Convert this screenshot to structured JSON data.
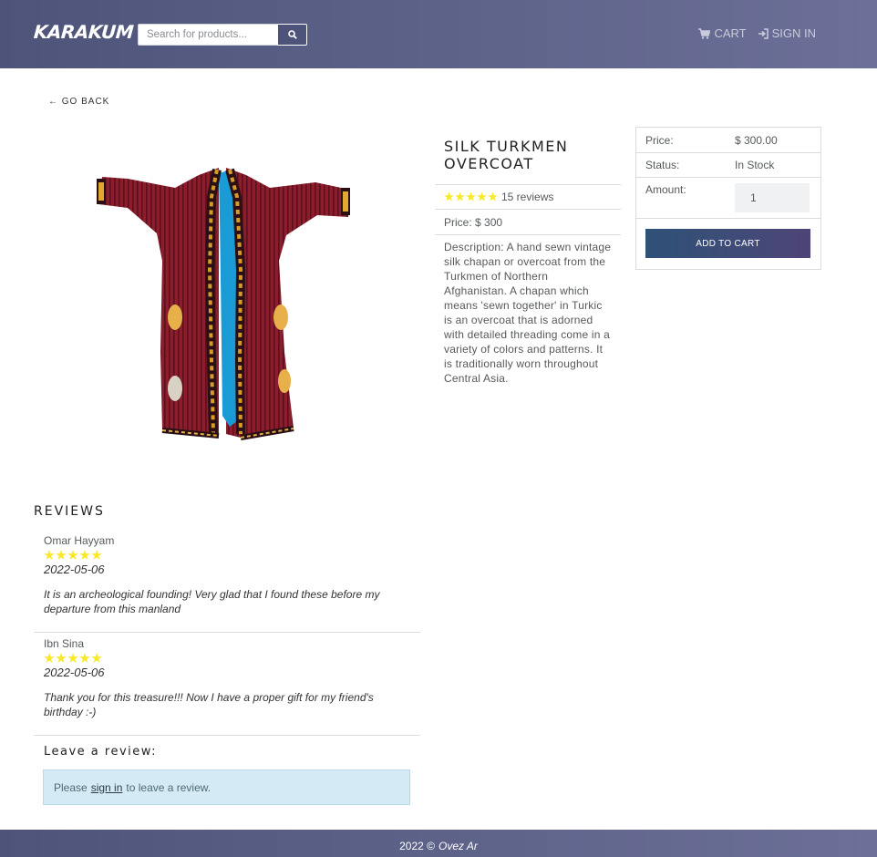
{
  "navbar": {
    "brand": "KARAKUM",
    "search": {
      "placeholder": "Search for products...",
      "button_icon": "search-icon"
    },
    "links": [
      {
        "label": "CART",
        "icon": "cart-icon"
      },
      {
        "label": "SIGN IN",
        "icon": "sign-in-icon"
      }
    ],
    "gradient_colors": [
      "#4e5479",
      "#6c7098"
    ]
  },
  "go_back": "← GO BACK",
  "product": {
    "name": "SILK TURKMEN OVERCOAT",
    "rating": 5,
    "reviews_count_label": "15 reviews",
    "price_label": "Price: $ 300",
    "description": "Description: A hand sewn vintage silk chapan or overcoat from the Turkmen of Northern Afghanistan. A chapan which means 'sewn together' in Turkic is an overcoat that is adorned with detailed threading come in a variety of colors and patterns. It is traditionally worn throughout Central Asia.",
    "image_icon": "chapan-overcoat-image"
  },
  "order_card": {
    "price_label": "Price:",
    "price_value": "$ 300.00",
    "status_label": "Status:",
    "status_value": "In Stock",
    "amount_label": "Amount:",
    "amount_value": "1",
    "add_button": "ADD TO CART"
  },
  "reviews": {
    "heading": "REVIEWS",
    "items": [
      {
        "name": "Omar Hayyam",
        "rating": 5,
        "date": "2022-05-06",
        "text": "It is an archeological founding! Very glad that I found these before my departure from this manland"
      },
      {
        "name": "Ibn Sina",
        "rating": 5,
        "date": "2022-05-06",
        "text": "Thank you for this treasure!!! Now I have a proper gift for my friend's birthday :-)"
      }
    ],
    "leave_heading": "Leave a review:",
    "alert_prefix": "Please",
    "alert_link": "sign in",
    "alert_suffix": "to leave a review."
  },
  "footer": {
    "year": "2022 ©",
    "author": "Ovez Ar"
  },
  "colors": {
    "star": "#f8e825",
    "alert_bg": "#d4ebf5"
  }
}
